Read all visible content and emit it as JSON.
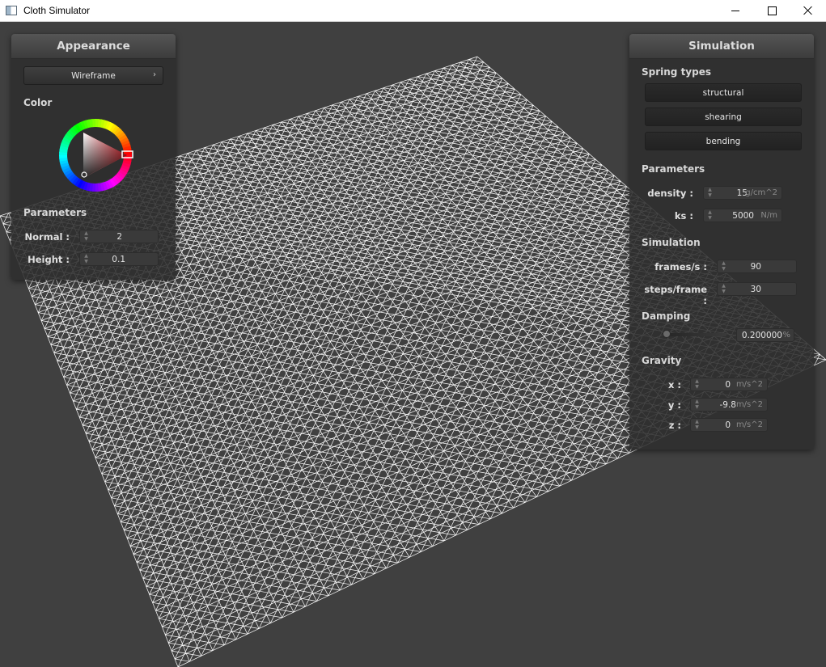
{
  "window": {
    "title": "Cloth Simulator",
    "controls": {
      "minimize": "minimize",
      "maximize": "maximize",
      "close": "close"
    }
  },
  "appearance": {
    "title": "Appearance",
    "shader_dropdown": {
      "selected": "Wireframe"
    },
    "color_label": "Color",
    "color_wheel": {
      "selected_hue_color": "#e0202a"
    },
    "parameters_label": "Parameters",
    "normal": {
      "label": "Normal :",
      "value": "2"
    },
    "height": {
      "label": "Height :",
      "value": "0.1"
    }
  },
  "simulation": {
    "title": "Simulation",
    "spring_types_label": "Spring types",
    "spring_buttons": [
      "structural",
      "shearing",
      "bending"
    ],
    "parameters_label": "Parameters",
    "density": {
      "label": "density :",
      "value": "15",
      "unit": "g/cm^2"
    },
    "ks": {
      "label": "ks :",
      "value": "5000",
      "unit": "N/m"
    },
    "simulation_label": "Simulation",
    "frames_per_s": {
      "label": "frames/s :",
      "value": "90"
    },
    "steps_per_frame": {
      "label": "steps/frame :",
      "value": "30"
    },
    "damping_label": "Damping",
    "damping": {
      "value": "0.200000",
      "unit": "%",
      "level": 0.002
    },
    "gravity_label": "Gravity",
    "gravity": {
      "x": {
        "label": "x :",
        "value": "0",
        "unit": "m/s^2"
      },
      "y": {
        "label": "y :",
        "value": "-9.8",
        "unit": "m/s^2"
      },
      "z": {
        "label": "z :",
        "value": "0",
        "unit": "m/s^2"
      }
    }
  },
  "colors": {
    "viewport_background": "#404040",
    "cloth_wire": "#ffffff",
    "panel_background": "#2e2e2e"
  }
}
